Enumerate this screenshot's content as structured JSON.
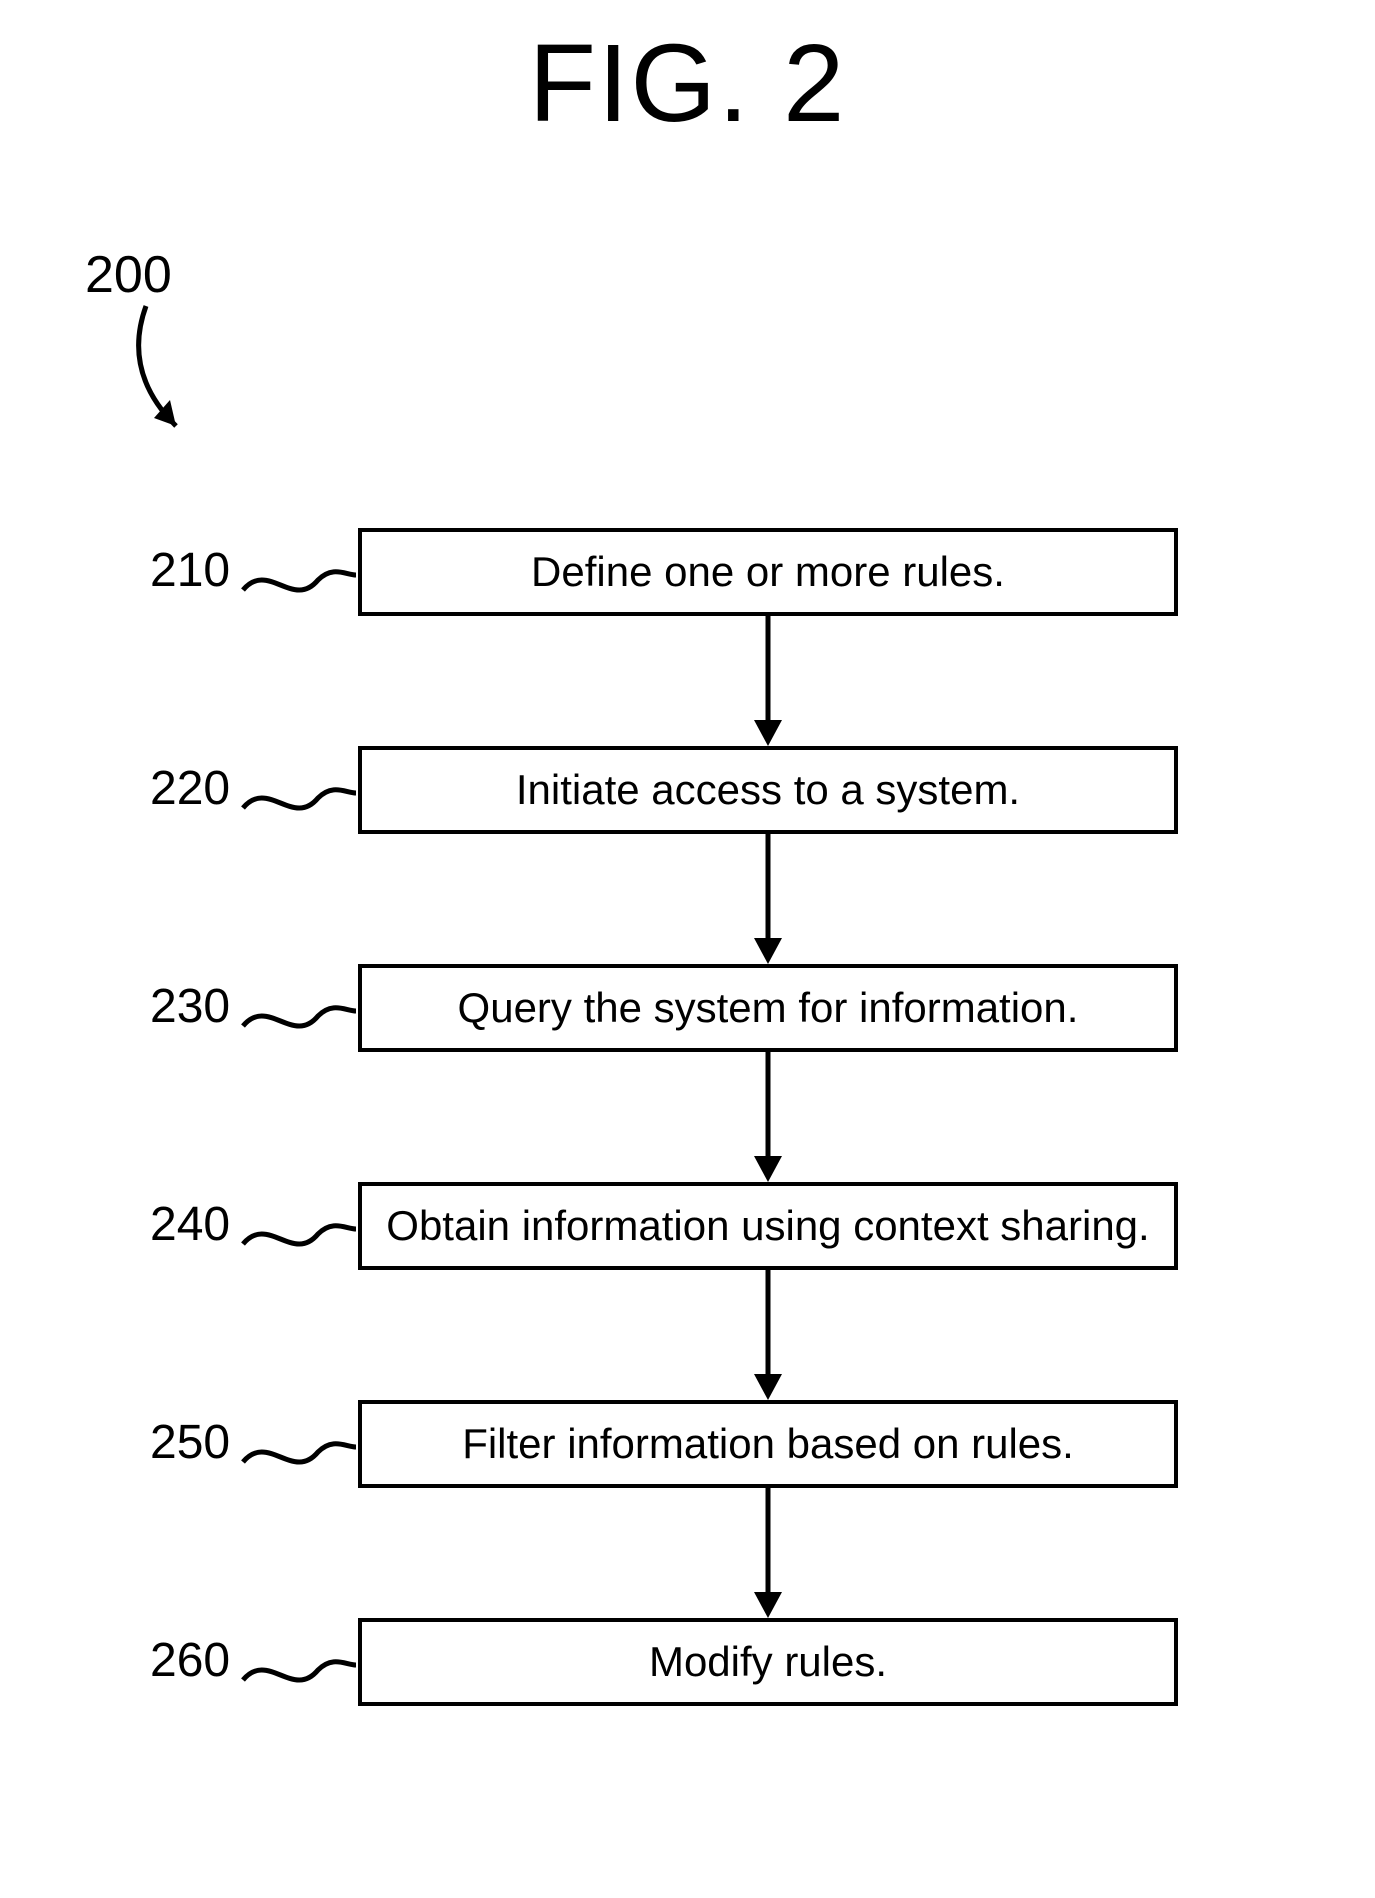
{
  "figure": {
    "title": "FIG. 2",
    "overall_ref": "200"
  },
  "steps": [
    {
      "ref": "210",
      "label": "Define one or more rules."
    },
    {
      "ref": "220",
      "label": "Initiate access to a system."
    },
    {
      "ref": "230",
      "label": "Query the system for information."
    },
    {
      "ref": "240",
      "label": "Obtain information using context sharing."
    },
    {
      "ref": "250",
      "label": "Filter information based on rules."
    },
    {
      "ref": "260",
      "label": "Modify rules."
    }
  ]
}
